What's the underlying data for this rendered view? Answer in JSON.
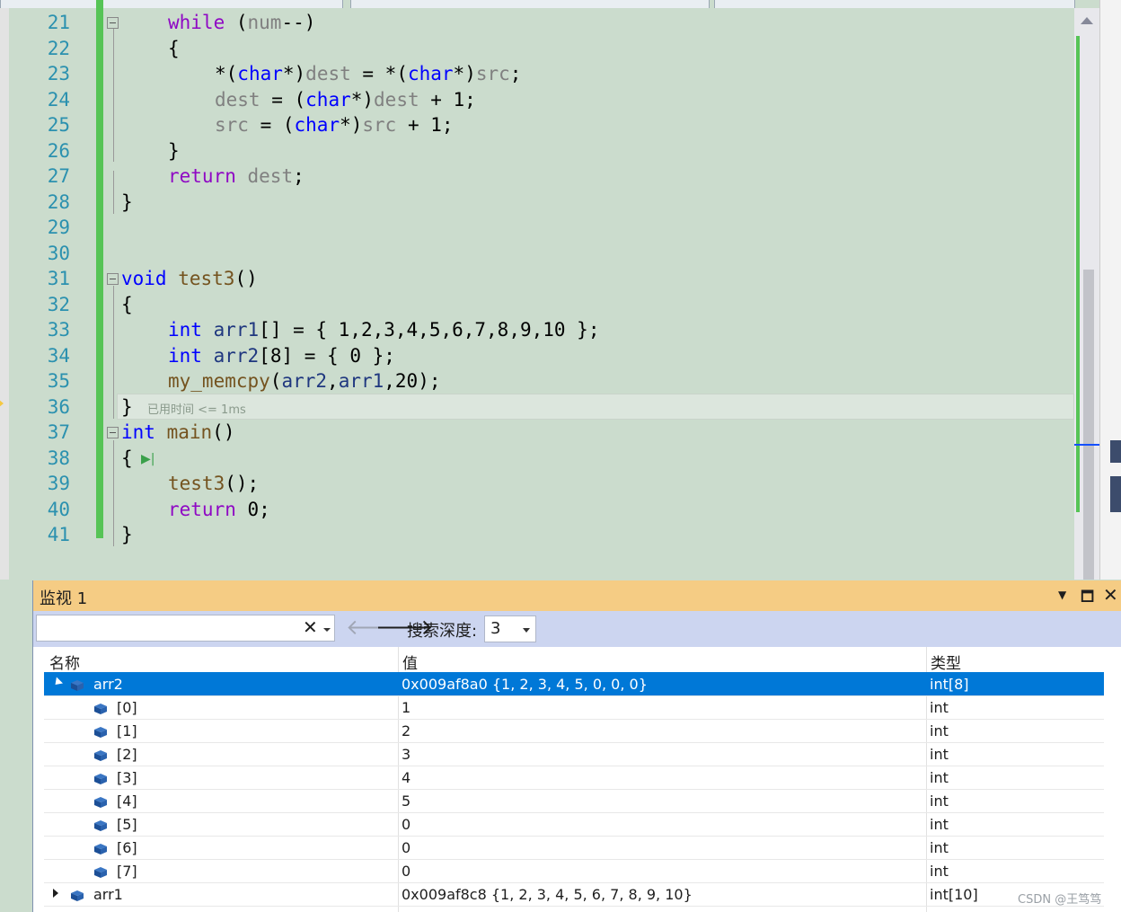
{
  "editor": {
    "lines": [
      {
        "num": "21"
      },
      {
        "num": "22"
      },
      {
        "num": "23"
      },
      {
        "num": "24"
      },
      {
        "num": "25"
      },
      {
        "num": "26"
      },
      {
        "num": "27"
      },
      {
        "num": "28"
      },
      {
        "num": "29"
      },
      {
        "num": "30"
      },
      {
        "num": "31"
      },
      {
        "num": "32"
      },
      {
        "num": "33"
      },
      {
        "num": "34"
      },
      {
        "num": "35"
      },
      {
        "num": "36"
      },
      {
        "num": "37"
      },
      {
        "num": "38"
      },
      {
        "num": "39"
      },
      {
        "num": "40"
      },
      {
        "num": "41"
      }
    ],
    "code": {
      "l21_kw": "while",
      "l21_rest": " (",
      "l21_param": "num",
      "l21_end": "--)",
      "l22": "{",
      "l23_a": "*(",
      "l23_type1": "char",
      "l23_b": "*)",
      "l23_dest": "dest",
      "l23_c": " = *(",
      "l23_type2": "char",
      "l23_d": "*)",
      "l23_src": "src",
      "l23_e": ";",
      "l24_dest": "dest",
      "l24_a": " = (",
      "l24_type": "char",
      "l24_b": "*)",
      "l24_dest2": "dest",
      "l24_c": " + 1;",
      "l25_src": "src",
      "l25_a": " = (",
      "l25_type": "char",
      "l25_b": "*)",
      "l25_src2": "src",
      "l25_c": " + 1;",
      "l26": "}",
      "l27_kw": "return",
      "l27_sp": " ",
      "l27_dest": "dest",
      "l27_end": ";",
      "l28": "}",
      "l31_type": "void",
      "l31_sp": " ",
      "l31_fn": "test3",
      "l31_end": "()",
      "l32": "{",
      "l33_type": "int",
      "l33_sp": " ",
      "l33_var": "arr1",
      "l33_rest": "[] = { 1,2,3,4,5,6,7,8,9,10 };",
      "l34_type": "int",
      "l34_sp": " ",
      "l34_var": "arr2",
      "l34_rest": "[8] = { 0 };",
      "l35_fn": "my_memcpy",
      "l35_a": "(",
      "l35_v1": "arr2",
      "l35_b": ",",
      "l35_v2": "arr1",
      "l35_c": ",20);",
      "l36": "}",
      "l36_elapsed": "已用时间 <= 1ms",
      "l37_type": "int",
      "l37_sp": " ",
      "l37_fn": "main",
      "l37_end": "()",
      "l38": "{",
      "l39_fn": "test3",
      "l39_end": "();",
      "l40_kw": "return",
      "l40_rest": " 0;",
      "l41": "}"
    }
  },
  "watch": {
    "title": "监视 1",
    "search_placeholder": "",
    "search_clear": "✕",
    "depth_label": "搜索深度:",
    "depth_value": "3",
    "columns": {
      "name": "名称",
      "value": "值",
      "type": "类型"
    },
    "rows": [
      {
        "name": "arr2",
        "value": "0x009af8a0 {1, 2, 3, 4, 5, 0, 0, 0}",
        "type": "int[8]"
      },
      {
        "name": "[0]",
        "value": "1",
        "type": "int"
      },
      {
        "name": "[1]",
        "value": "2",
        "type": "int"
      },
      {
        "name": "[2]",
        "value": "3",
        "type": "int"
      },
      {
        "name": "[3]",
        "value": "4",
        "type": "int"
      },
      {
        "name": "[4]",
        "value": "5",
        "type": "int"
      },
      {
        "name": "[5]",
        "value": "0",
        "type": "int"
      },
      {
        "name": "[6]",
        "value": "0",
        "type": "int"
      },
      {
        "name": "[7]",
        "value": "0",
        "type": "int"
      },
      {
        "name": "arr1",
        "value": "0x009af8c8 {1, 2, 3, 4, 5, 6, 7, 8, 9, 10}",
        "type": "int[10]"
      }
    ]
  },
  "watermark": "CSDN @王笃笃",
  "colors": {
    "editor_bg": "#cbdccd",
    "line_numbers": "#2b91af",
    "keyword": "#8f08c4",
    "type": "#0000ff",
    "selection": "#0078d7",
    "watch_title_bg": "#f5cc84",
    "change_bar": "#56c456"
  },
  "icons": {
    "watch_variable": "cube-icon",
    "back": "arrow-left-icon",
    "forward": "arrow-right-icon"
  }
}
